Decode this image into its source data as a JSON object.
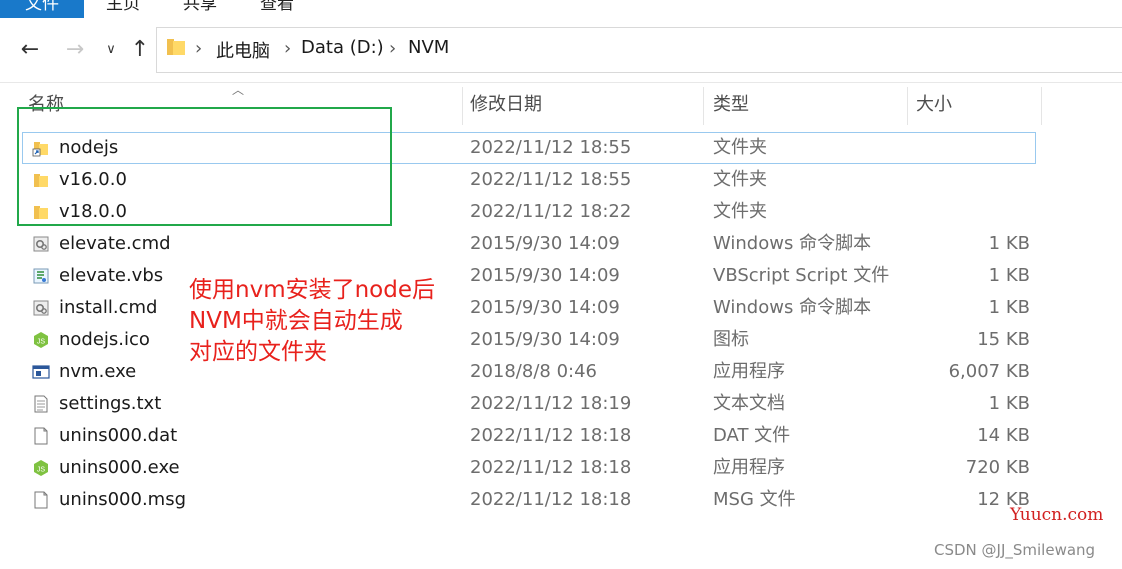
{
  "ribbon": {
    "tabs": [
      "文件",
      "主页",
      "共享",
      "查看"
    ]
  },
  "address": {
    "crumbs": [
      "此电脑",
      "Data (D:)",
      "NVM"
    ]
  },
  "columns": {
    "name": "名称",
    "date": "修改日期",
    "type": "类型",
    "size": "大小"
  },
  "files": [
    {
      "name": "nodejs",
      "date": "2022/11/12 18:55",
      "type": "文件夹",
      "size": "",
      "icon": "folder-shortcut-icon"
    },
    {
      "name": "v16.0.0",
      "date": "2022/11/12 18:55",
      "type": "文件夹",
      "size": "",
      "icon": "folder-icon"
    },
    {
      "name": "v18.0.0",
      "date": "2022/11/12 18:22",
      "type": "文件夹",
      "size": "",
      "icon": "folder-icon"
    },
    {
      "name": "elevate.cmd",
      "date": "2015/9/30 14:09",
      "type": "Windows 命令脚本",
      "size": "1 KB",
      "icon": "cmd-script-icon"
    },
    {
      "name": "elevate.vbs",
      "date": "2015/9/30 14:09",
      "type": "VBScript Script 文件",
      "size": "1 KB",
      "icon": "vbs-script-icon"
    },
    {
      "name": "install.cmd",
      "date": "2015/9/30 14:09",
      "type": "Windows 命令脚本",
      "size": "1 KB",
      "icon": "cmd-script-icon"
    },
    {
      "name": "nodejs.ico",
      "date": "2015/9/30 14:09",
      "type": "图标",
      "size": "15 KB",
      "icon": "nodejs-icon"
    },
    {
      "name": "nvm.exe",
      "date": "2018/8/8 0:46",
      "type": "应用程序",
      "size": "6,007 KB",
      "icon": "exe-icon"
    },
    {
      "name": "settings.txt",
      "date": "2022/11/12 18:19",
      "type": "文本文档",
      "size": "1 KB",
      "icon": "text-file-icon"
    },
    {
      "name": "unins000.dat",
      "date": "2022/11/12 18:18",
      "type": "DAT 文件",
      "size": "14 KB",
      "icon": "blank-file-icon"
    },
    {
      "name": "unins000.exe",
      "date": "2022/11/12 18:18",
      "type": "应用程序",
      "size": "720 KB",
      "icon": "nodejs-icon"
    },
    {
      "name": "unins000.msg",
      "date": "2022/11/12 18:18",
      "type": "MSG 文件",
      "size": "12 KB",
      "icon": "blank-file-icon"
    }
  ],
  "annotation": {
    "lines": [
      "使用nvm安装了node后",
      "NVM中就会自动生成",
      "对应的文件夹"
    ]
  },
  "watermarks": {
    "site": "Yuucn.com",
    "author": "CSDN @JJ_Smilewang"
  },
  "colors": {
    "accent": "#1979ca",
    "highlight_box": "#21a84a",
    "annotation": "#e8211c",
    "selection": "#99c9ef"
  }
}
